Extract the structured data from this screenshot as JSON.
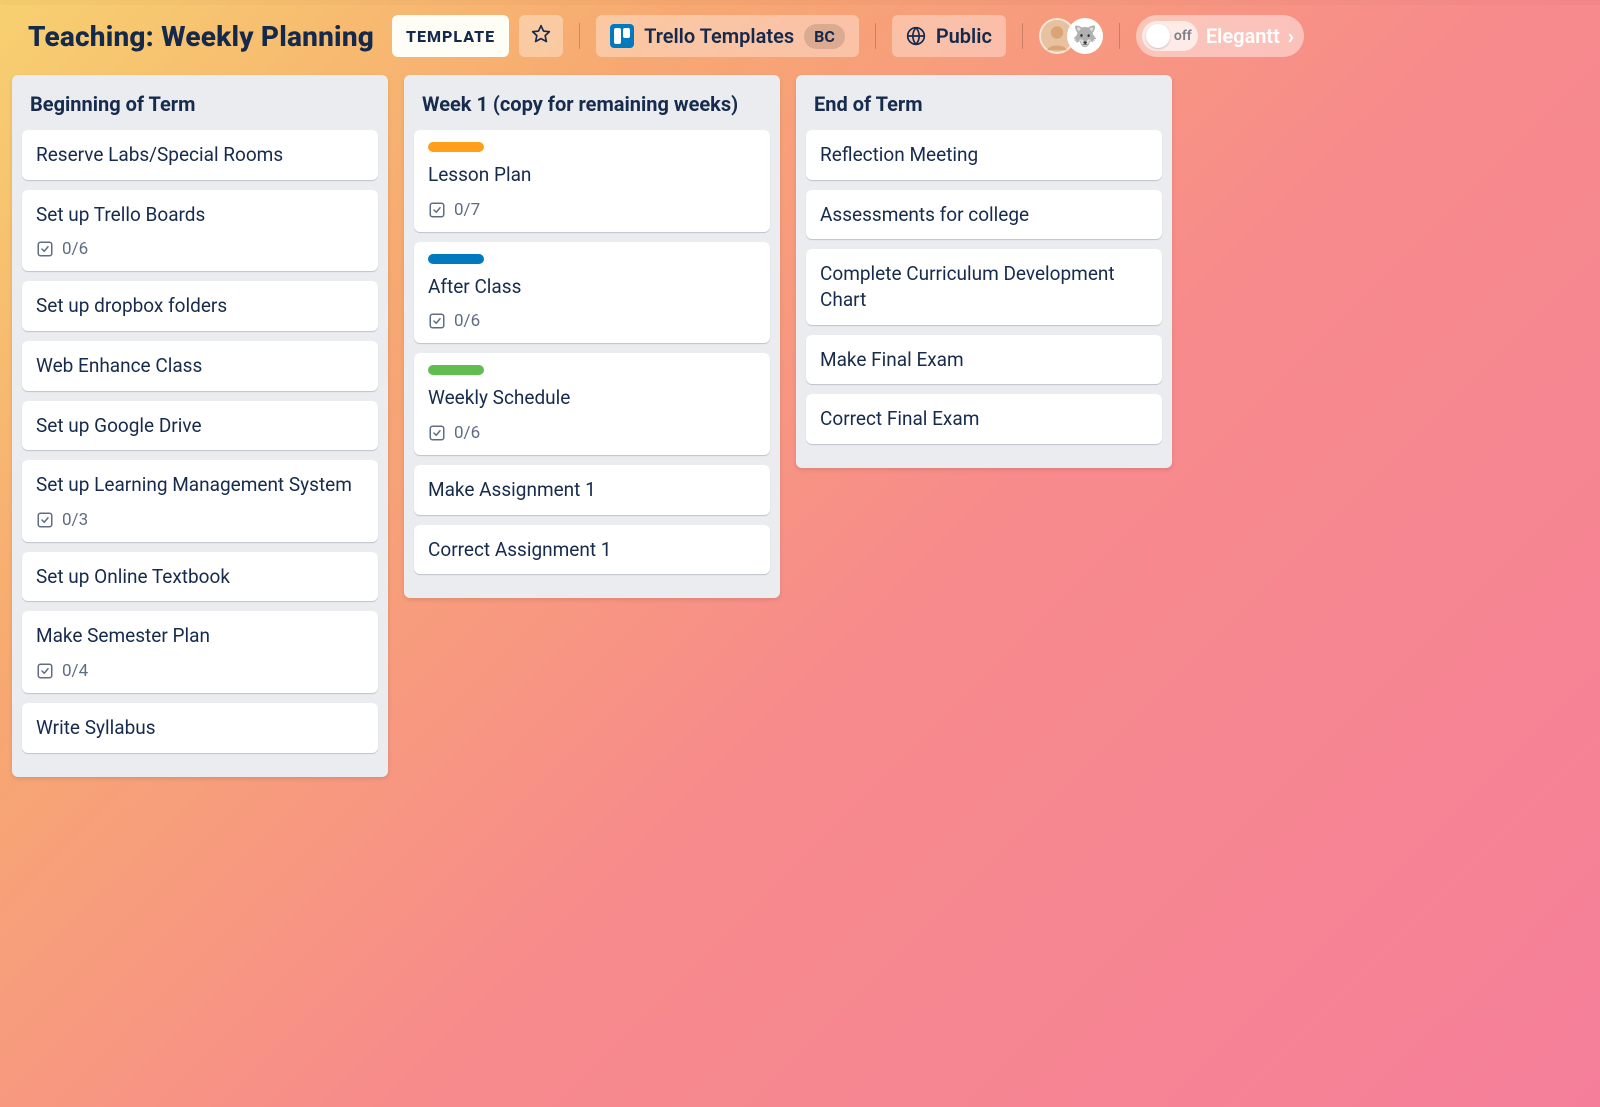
{
  "header": {
    "title": "Teaching: Weekly Planning",
    "template_label": "TEMPLATE",
    "workspace_label": "Trello Templates",
    "workspace_badge": "BC",
    "visibility": "Public",
    "toggle_state": "off",
    "powerup_label": "Elegantt"
  },
  "lists": [
    {
      "title": "Beginning of Term",
      "cards": [
        {
          "title": "Reserve Labs/Special Rooms"
        },
        {
          "title": "Set up Trello Boards",
          "checklist": "0/6"
        },
        {
          "title": "Set up dropbox folders"
        },
        {
          "title": "Web Enhance Class"
        },
        {
          "title": "Set up Google Drive"
        },
        {
          "title": "Set up Learning Management System",
          "checklist": "0/3"
        },
        {
          "title": "Set up Online Textbook"
        },
        {
          "title": "Make Semester Plan",
          "checklist": "0/4"
        },
        {
          "title": "Write Syllabus"
        }
      ]
    },
    {
      "title": "Week 1 (copy for remaining weeks)",
      "cards": [
        {
          "label": "orange",
          "title": "Lesson Plan",
          "checklist": "0/7"
        },
        {
          "label": "blue",
          "title": "After Class",
          "checklist": "0/6"
        },
        {
          "label": "green",
          "title": "Weekly Schedule",
          "checklist": "0/6"
        },
        {
          "title": "Make Assignment 1"
        },
        {
          "title": "Correct Assignment 1"
        }
      ]
    },
    {
      "title": "End of Term",
      "cards": [
        {
          "title": "Reflection Meeting"
        },
        {
          "title": "Assessments for college"
        },
        {
          "title": "Complete Curriculum Development Chart"
        },
        {
          "title": "Make Final Exam"
        },
        {
          "title": "Correct Final Exam"
        }
      ]
    }
  ],
  "colors": {
    "label_orange": "#ff9f1a",
    "label_blue": "#0079bf",
    "label_green": "#61bd4f"
  }
}
